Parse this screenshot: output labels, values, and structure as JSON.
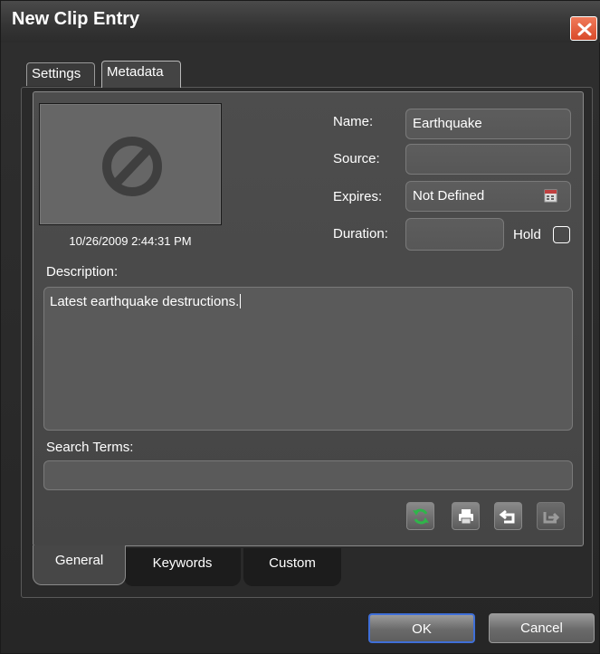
{
  "window": {
    "title": "New Clip Entry"
  },
  "tabs": {
    "outer": [
      "Settings",
      "Metadata"
    ],
    "active": "Metadata"
  },
  "clip": {
    "timestamp": "10/26/2009 2:44:31 PM",
    "thumbnail_icon": "no-preview-icon"
  },
  "fields": {
    "name_label": "Name:",
    "name_value": "Earthquake",
    "source_label": "Source:",
    "source_value": "",
    "expires_label": "Expires:",
    "expires_value": "Not Defined",
    "duration_label": "Duration:",
    "duration_value": "",
    "hold_label": "Hold",
    "hold_checked": false,
    "description_label": "Description:",
    "description_value": "Latest earthquake destructions.",
    "search_terms_label": "Search Terms:",
    "search_terms_value": ""
  },
  "toolbar": {
    "icons": [
      "refresh-icon",
      "print-icon",
      "undo-icon",
      "export-icon"
    ]
  },
  "bottom_tabs": {
    "items": [
      "General",
      "Keywords",
      "Custom"
    ],
    "active": "General"
  },
  "buttons": {
    "ok": "OK",
    "cancel": "Cancel"
  },
  "colors": {
    "close_button": "#e0553a",
    "ok_focus": "#3f6fd8",
    "refresh_green": "#2fb54a"
  }
}
